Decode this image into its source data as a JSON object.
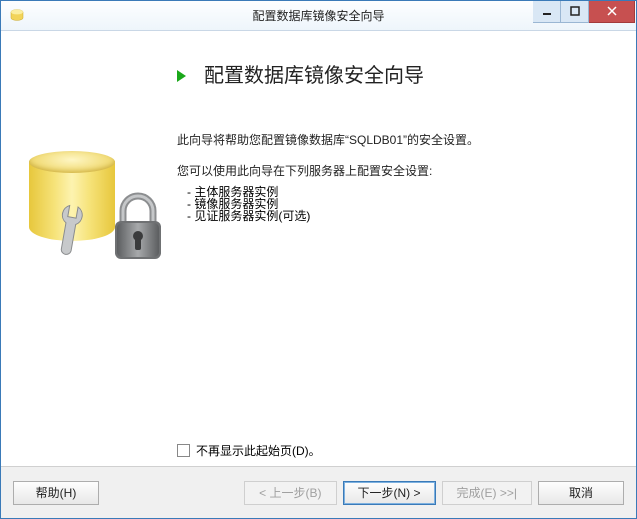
{
  "window": {
    "title": "配置数据库镜像安全向导"
  },
  "heading": "配置数据库镜像安全向导",
  "intro": "此向导将帮助您配置镜像数据库“SQLDB01”的安全设置。",
  "sub": "您可以使用此向导在下列服务器上配置安全设置:",
  "bullets": {
    "b1": "主体服务器实例",
    "b2": "镜像服务器实例",
    "b3": "见证服务器实例(可选)"
  },
  "checkbox": {
    "label": "不再显示此起始页(D)。"
  },
  "footer": {
    "help": "帮助(H)",
    "back": "< 上一步(B)",
    "next": "下一步(N) >",
    "finish": "完成(E) >>|",
    "cancel": "取消"
  }
}
